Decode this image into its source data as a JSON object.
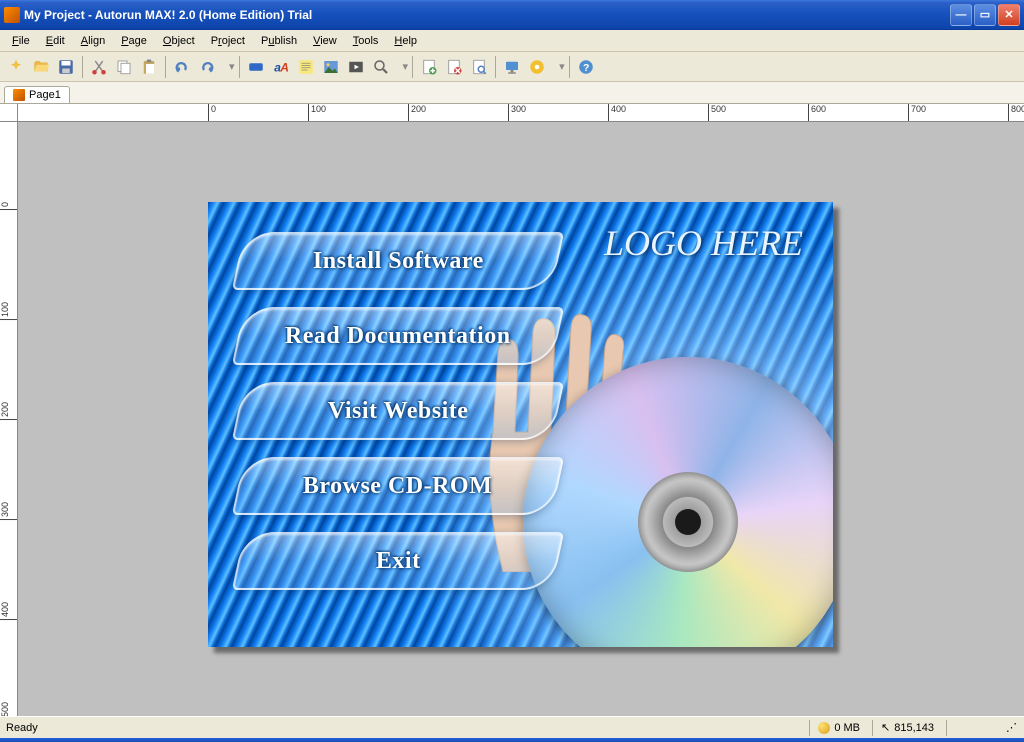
{
  "window": {
    "title": "My Project - Autorun MAX! 2.0 (Home Edition) Trial"
  },
  "menu": {
    "file": "File",
    "edit": "Edit",
    "align": "Align",
    "page": "Page",
    "object": "Object",
    "project": "Project",
    "publish": "Publish",
    "view": "View",
    "tools": "Tools",
    "help": "Help"
  },
  "tabs": {
    "page1": "Page1"
  },
  "ruler_h": [
    "0",
    "100",
    "200",
    "300",
    "400",
    "500",
    "600",
    "700",
    "800"
  ],
  "ruler_v": [
    "0",
    "100",
    "200",
    "300",
    "400",
    "500"
  ],
  "canvas": {
    "logo": "LOGO HERE",
    "buttons": {
      "install": "Install Software",
      "docs": "Read Documentation",
      "visit": "Visit Website",
      "browse": "Browse CD-ROM",
      "exit": "Exit"
    }
  },
  "status": {
    "ready": "Ready",
    "mem": "0 MB",
    "coords": "815,143"
  }
}
